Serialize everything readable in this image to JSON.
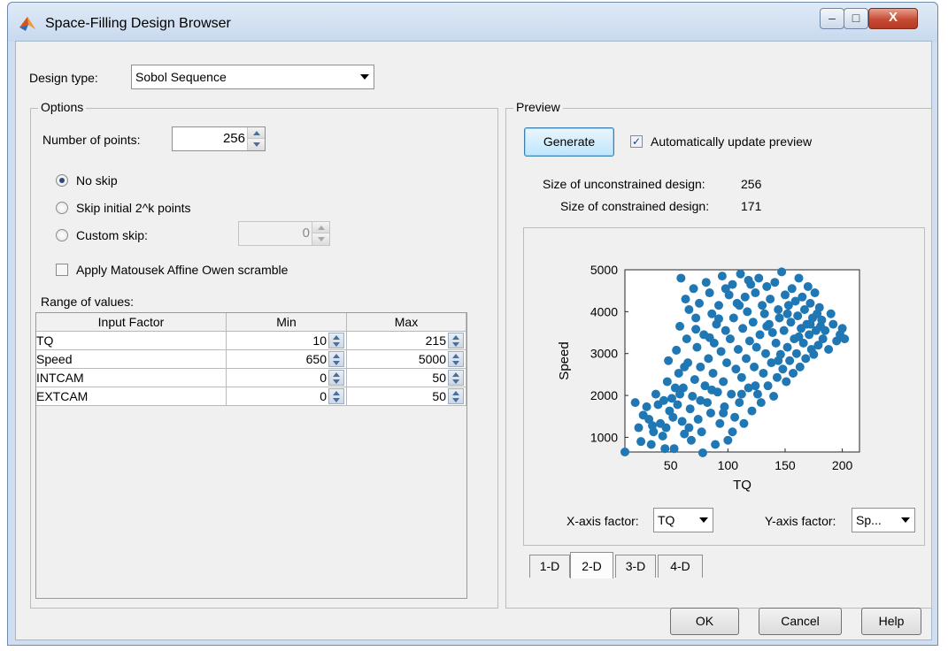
{
  "window": {
    "title": "Space-Filling Design Browser",
    "minimize_glyph": "–",
    "maximize_glyph": "□",
    "close_glyph": "X"
  },
  "design_type": {
    "label": "Design type:",
    "value": "Sobol Sequence"
  },
  "options": {
    "title": "Options",
    "num_points_label": "Number of points:",
    "num_points_value": "256",
    "radios": [
      {
        "label": "No skip",
        "selected": true
      },
      {
        "label": "Skip initial 2^k points",
        "selected": false
      },
      {
        "label": "Custom skip:",
        "selected": false
      }
    ],
    "custom_skip_value": "0",
    "scramble_label": "Apply Matousek Affine Owen scramble",
    "scramble_checked": false,
    "range_label": "Range of values:",
    "table_headers": [
      "Input Factor",
      "Min",
      "Max"
    ],
    "table_rows": [
      {
        "factor": "TQ",
        "min": "10",
        "max": "215"
      },
      {
        "factor": "Speed",
        "min": "650",
        "max": "5000"
      },
      {
        "factor": "INTCAM",
        "min": "0",
        "max": "50"
      },
      {
        "factor": "EXTCAM",
        "min": "0",
        "max": "50"
      }
    ]
  },
  "preview": {
    "title": "Preview",
    "generate_label": "Generate",
    "auto_update_label": "Automatically update preview",
    "auto_update_checked": true,
    "unconstrained_label": "Size of unconstrained design:",
    "unconstrained_value": "256",
    "constrained_label": "Size of constrained design:",
    "constrained_value": "171",
    "x_axis_label": "X-axis factor:",
    "x_axis_value": "TQ",
    "y_axis_label": "Y-axis factor:",
    "y_axis_value": "Sp...",
    "tabs": [
      "1-D",
      "2-D",
      "3-D",
      "4-D"
    ],
    "selected_tab": "2-D"
  },
  "buttons": {
    "ok": "OK",
    "cancel": "Cancel",
    "help": "Help"
  },
  "chart_data": {
    "type": "scatter",
    "xlabel": "TQ",
    "ylabel": "Speed",
    "xlim": [
      10,
      215
    ],
    "ylim": [
      650,
      5000
    ],
    "xticks": [
      50,
      100,
      150,
      200
    ],
    "yticks": [
      1000,
      2000,
      3000,
      4000,
      5000
    ],
    "color": "#1f77b4",
    "points": [
      [
        10,
        650
      ],
      [
        19,
        1830
      ],
      [
        22,
        1230
      ],
      [
        24,
        900
      ],
      [
        29,
        1730
      ],
      [
        31,
        1430
      ],
      [
        33,
        830
      ],
      [
        35,
        1130
      ],
      [
        37,
        2030
      ],
      [
        39,
        1780
      ],
      [
        41,
        1330
      ],
      [
        43,
        1030
      ],
      [
        45,
        730
      ],
      [
        46,
        1230
      ],
      [
        47,
        2330
      ],
      [
        48,
        2830
      ],
      [
        49,
        1630
      ],
      [
        51,
        1930
      ],
      [
        52,
        1480
      ],
      [
        53,
        730
      ],
      [
        55,
        3080
      ],
      [
        56,
        1780
      ],
      [
        57,
        2530
      ],
      [
        58,
        3650
      ],
      [
        59,
        4800
      ],
      [
        60,
        1380
      ],
      [
        61,
        2180
      ],
      [
        62,
        1080
      ],
      [
        63,
        4300
      ],
      [
        64,
        3350
      ],
      [
        65,
        2780
      ],
      [
        66,
        4050
      ],
      [
        67,
        1680
      ],
      [
        68,
        930
      ],
      [
        69,
        1980
      ],
      [
        70,
        4550
      ],
      [
        71,
        2380
      ],
      [
        72,
        3850
      ],
      [
        73,
        3150
      ],
      [
        74,
        1430
      ],
      [
        75,
        4200
      ],
      [
        76,
        2680
      ],
      [
        77,
        1130
      ],
      [
        78,
        630
      ],
      [
        79,
        3450
      ],
      [
        80,
        2230
      ],
      [
        81,
        4700
      ],
      [
        82,
        1830
      ],
      [
        83,
        2880
      ],
      [
        84,
        4450
      ],
      [
        85,
        1580
      ],
      [
        86,
        3950
      ],
      [
        87,
        2530
      ],
      [
        88,
        3250
      ],
      [
        89,
        830
      ],
      [
        90,
        3700
      ],
      [
        91,
        2080
      ],
      [
        92,
        4150
      ],
      [
        93,
        1330
      ],
      [
        94,
        3050
      ],
      [
        95,
        4850
      ],
      [
        96,
        2330
      ],
      [
        97,
        1730
      ],
      [
        98,
        3550
      ],
      [
        99,
        2780
      ],
      [
        100,
        930
      ],
      [
        101,
        4400
      ],
      [
        102,
        3350
      ],
      [
        103,
        2030
      ],
      [
        104,
        4650
      ],
      [
        105,
        3850
      ],
      [
        106,
        1480
      ],
      [
        107,
        2630
      ],
      [
        108,
        4200
      ],
      [
        109,
        3100
      ],
      [
        110,
        1830
      ],
      [
        111,
        4900
      ],
      [
        112,
        2430
      ],
      [
        113,
        3600
      ],
      [
        114,
        1330
      ],
      [
        115,
        4350
      ],
      [
        116,
        2880
      ],
      [
        117,
        4000
      ],
      [
        118,
        2180
      ],
      [
        119,
        3300
      ],
      [
        120,
        4650
      ],
      [
        121,
        1630
      ],
      [
        122,
        3750
      ],
      [
        123,
        2680
      ],
      [
        124,
        4450
      ],
      [
        125,
        3150
      ],
      [
        126,
        2030
      ],
      [
        127,
        4800
      ],
      [
        128,
        3450
      ],
      [
        129,
        1830
      ],
      [
        130,
        4150
      ],
      [
        131,
        2530
      ],
      [
        132,
        3950
      ],
      [
        133,
        3000
      ],
      [
        134,
        4600
      ],
      [
        135,
        2230
      ],
      [
        136,
        3700
      ],
      [
        137,
        4300
      ],
      [
        138,
        2780
      ],
      [
        139,
        3500
      ],
      [
        140,
        1980
      ],
      [
        141,
        4700
      ],
      [
        142,
        3250
      ],
      [
        143,
        2430
      ],
      [
        144,
        4050
      ],
      [
        145,
        3850
      ],
      [
        146,
        2980
      ],
      [
        147,
        4950
      ],
      [
        148,
        2630
      ],
      [
        149,
        3550
      ],
      [
        150,
        4400
      ],
      [
        151,
        2330
      ],
      [
        152,
        3150
      ],
      [
        153,
        4150
      ],
      [
        154,
        2830
      ],
      [
        155,
        3750
      ],
      [
        156,
        4550
      ],
      [
        157,
        2530
      ],
      [
        158,
        3350
      ],
      [
        159,
        4250
      ],
      [
        160,
        3000
      ],
      [
        161,
        3900
      ],
      [
        162,
        4800
      ],
      [
        163,
        2680
      ],
      [
        164,
        3600
      ],
      [
        165,
        4350
      ],
      [
        166,
        3250
      ],
      [
        167,
        4050
      ],
      [
        168,
        2880
      ],
      [
        169,
        3700
      ],
      [
        170,
        4600
      ],
      [
        171,
        3450
      ],
      [
        172,
        4200
      ],
      [
        173,
        3100
      ],
      [
        174,
        3850
      ],
      [
        175,
        2980
      ],
      [
        176,
        4450
      ],
      [
        177,
        3550
      ],
      [
        178,
        3950
      ],
      [
        179,
        3200
      ],
      [
        180,
        4100
      ],
      [
        181,
        3650
      ],
      [
        182,
        3800
      ],
      [
        183,
        3350
      ],
      [
        185,
        3550
      ],
      [
        188,
        3100
      ],
      [
        190,
        3950
      ],
      [
        192,
        3700
      ],
      [
        195,
        3300
      ],
      [
        198,
        3450
      ],
      [
        200,
        3600
      ],
      [
        202,
        3350
      ],
      [
        26,
        1530
      ],
      [
        34,
        1280
      ],
      [
        44,
        1880
      ],
      [
        54,
        2180
      ],
      [
        66,
        1230
      ],
      [
        76,
        1880
      ],
      [
        86,
        2130
      ],
      [
        96,
        1580
      ],
      [
        58,
        2030
      ],
      [
        62,
        2680
      ],
      [
        72,
        3580
      ],
      [
        84,
        3380
      ],
      [
        92,
        3830
      ],
      [
        104,
        1130
      ],
      [
        112,
        2030
      ],
      [
        124,
        2230
      ],
      [
        134,
        3650
      ],
      [
        144,
        2830
      ],
      [
        152,
        3950
      ],
      [
        162,
        3400
      ],
      [
        172,
        3700
      ],
      [
        110,
        4150
      ],
      [
        118,
        4750
      ],
      [
        98,
        4550
      ]
    ]
  }
}
